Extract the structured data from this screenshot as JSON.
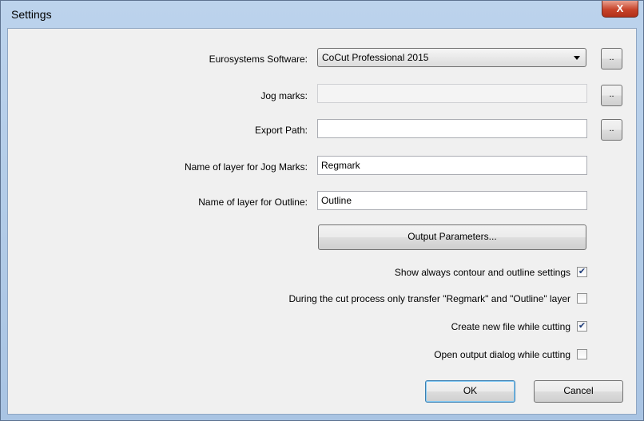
{
  "window": {
    "title": "Settings",
    "close_label": "X"
  },
  "software": {
    "label": "Eurosystems Software:",
    "value": "CoCut Professional 2015",
    "browse_label": ".."
  },
  "jog_marks": {
    "label": "Jog marks:",
    "value": "",
    "browse_label": ".."
  },
  "export_path": {
    "label": "Export Path:",
    "value": "",
    "browse_label": ".."
  },
  "jog_layer": {
    "label": "Name of layer for Jog Marks:",
    "value": "Regmark"
  },
  "outline_layer": {
    "label": "Name of layer for Outline:",
    "value": "Outline"
  },
  "output_parameters_label": "Output Parameters...",
  "options": [
    {
      "label": "Show always contour and outline settings",
      "checked": true
    },
    {
      "label": "During the cut process only transfer \"Regmark\" and \"Outline\" layer",
      "checked": false
    },
    {
      "label": "Create new file while cutting",
      "checked": true
    },
    {
      "label": "Open output dialog while cutting",
      "checked": false
    }
  ],
  "buttons": {
    "ok": "OK",
    "cancel": "Cancel"
  }
}
